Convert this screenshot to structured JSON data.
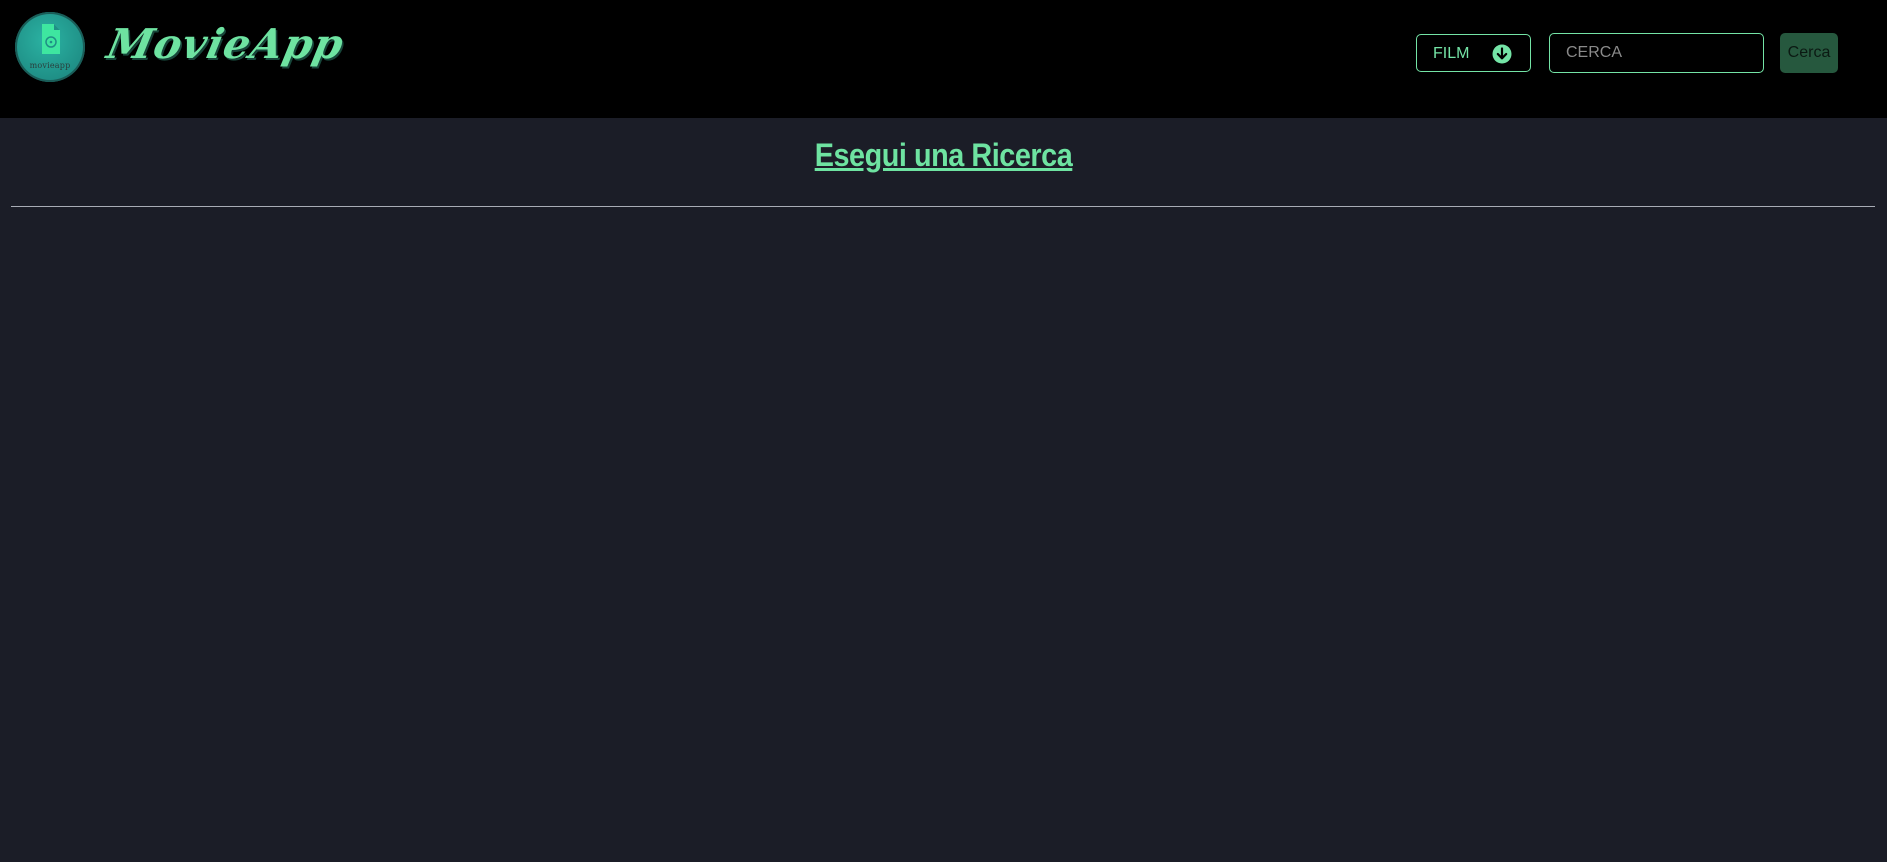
{
  "header": {
    "logo_text": "movieapp",
    "brand_name": "MovieApp",
    "category_select": {
      "selected": "FILM",
      "icon": "chevron-down-circle-icon"
    },
    "search": {
      "placeholder": "CERCA",
      "value": ""
    },
    "search_button_label": "Cerca"
  },
  "main": {
    "title": "Esegui una Ricerca"
  },
  "colors": {
    "accent": "#6ee3a1",
    "header_bg": "#000000",
    "page_bg": "#1b1d27",
    "button_bg": "#26583e"
  }
}
